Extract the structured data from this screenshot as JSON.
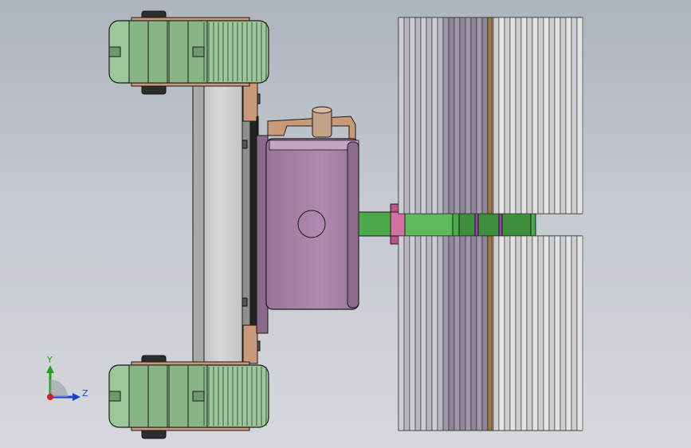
{
  "triad": {
    "y_label": "Y",
    "z_label": "Z",
    "y_color": "#1fa31f",
    "z_color": "#1f3fd6",
    "x_color": "#d42020"
  },
  "colors": {
    "background_top": "#aeb4bd",
    "background_bottom": "#d5d8dc",
    "wheel_tread": "#9cc79a",
    "wheel_hub": "#6f9a6c",
    "bracket": "#c89a78",
    "frame_plate": "#c6c6c6",
    "motor_housing": "#a883a7",
    "shaft": "#4caa4c",
    "coupling": "#d4709f",
    "brush_light": "#dcdcdc",
    "brush_mid": "#9c8fa6",
    "edge": "#1a1a1a"
  },
  "parts": [
    "wheel-top",
    "wheel-bottom",
    "frame-plate",
    "motor-housing",
    "drive-shaft",
    "brush-roller-upper",
    "brush-roller-lower"
  ]
}
